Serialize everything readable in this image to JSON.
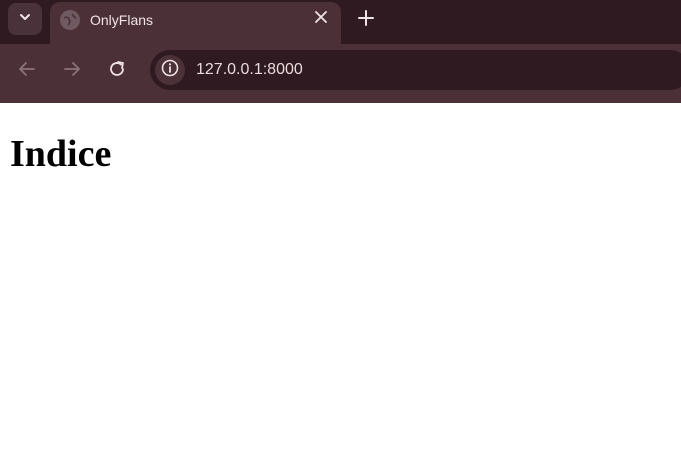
{
  "browser": {
    "tab": {
      "title": "OnlyFlans",
      "favicon_icon": "globe-icon",
      "close_icon": "close-icon"
    },
    "tab_search_icon": "chevron-down-icon",
    "new_tab_icon": "plus-icon",
    "toolbar": {
      "back_icon": "arrow-left-icon",
      "forward_icon": "arrow-right-icon",
      "reload_icon": "reload-icon",
      "site_info_icon": "info-icon",
      "url": "127.0.0.1:8000"
    },
    "colors": {
      "tabstrip": "#2e1a20",
      "active_tab": "#4c3038",
      "omnibox": "#2e1a20"
    }
  },
  "page": {
    "heading": "Indice"
  }
}
